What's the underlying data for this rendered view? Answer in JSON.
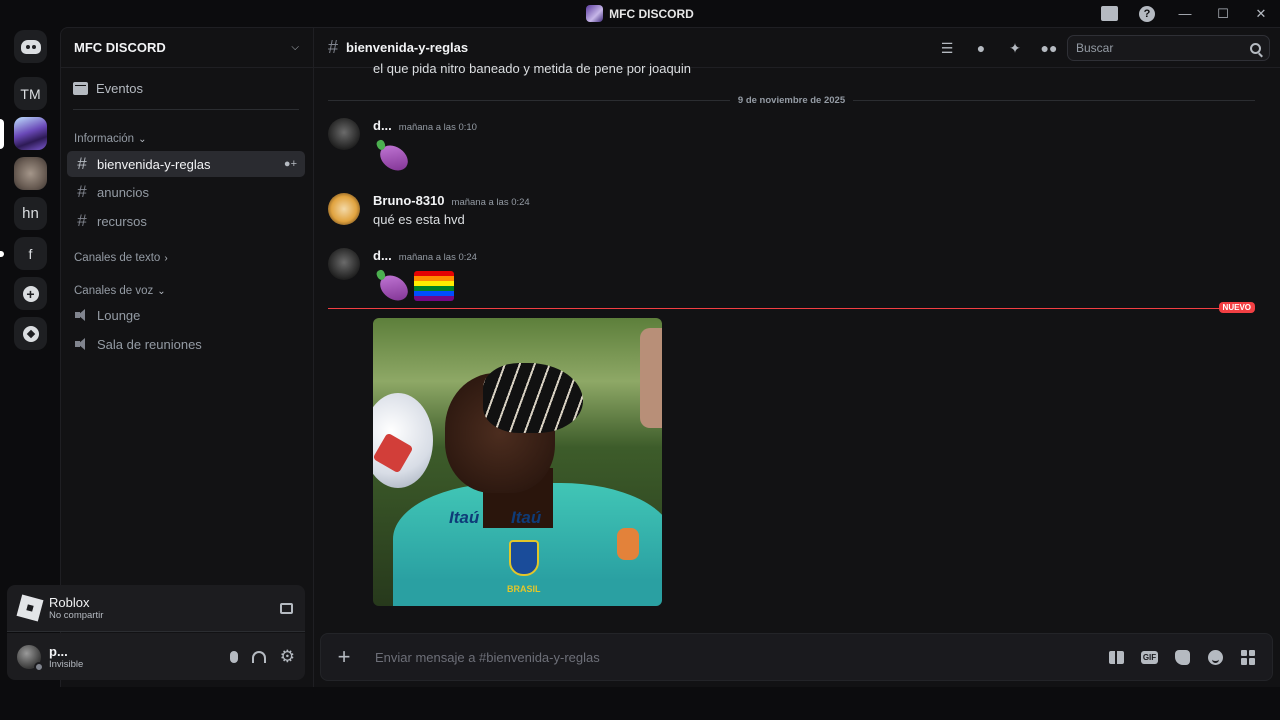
{
  "window": {
    "title": "MFC DISCORD",
    "controls": {
      "minimize": "—",
      "maximize": "☐",
      "close": "✕"
    }
  },
  "rail": {
    "servers": [
      {
        "label": "",
        "icon": "discord-logo-icon"
      },
      {
        "label": "TM"
      },
      {
        "label": "",
        "icon": "mfc-server-icon"
      },
      {
        "label": "",
        "icon": "cat-server-icon"
      },
      {
        "label": "hn"
      },
      {
        "label": "f"
      }
    ],
    "add_server_icon": "+",
    "discover_icon": "compass-icon"
  },
  "sidebar": {
    "server_name": "MFC DISCORD",
    "events_label": "Eventos",
    "categories": [
      {
        "label": "Información"
      },
      {
        "label": "Canales de texto"
      },
      {
        "label": "Canales de voz"
      }
    ],
    "text_channels": [
      {
        "name": "bienvenida-y-reglas",
        "active": true
      },
      {
        "name": "anuncios"
      },
      {
        "name": "recursos"
      }
    ],
    "voice_channels": [
      {
        "name": "Lounge"
      },
      {
        "name": "Sala de reuniones"
      }
    ]
  },
  "activity": {
    "title": "Roblox",
    "subtitle": "No compartir"
  },
  "user": {
    "name": "p...",
    "status": "Invisible"
  },
  "channel_header": {
    "name": "bienvenida-y-reglas",
    "search_placeholder": "Buscar"
  },
  "messages": {
    "previous_text": "el que pida nitro baneado y metida de pene por joaquin",
    "date_divider": "9 de noviembre de 2025",
    "items": [
      {
        "author": "d...",
        "time": "mañana a las 0:10",
        "content": ""
      },
      {
        "author": "Bruno-8310",
        "time": "mañana a las 0:24",
        "content": "qué es esta hvd"
      },
      {
        "author": "d...",
        "time": "mañana a las 0:24",
        "content": ""
      }
    ],
    "new_badge": "NUEVO",
    "photo_texts": {
      "sponsor": "Itaú",
      "crest": "BRASIL"
    }
  },
  "composer": {
    "placeholder": "Enviar mensaje a #bienvenida-y-reglas",
    "gif_label": "GIF"
  }
}
